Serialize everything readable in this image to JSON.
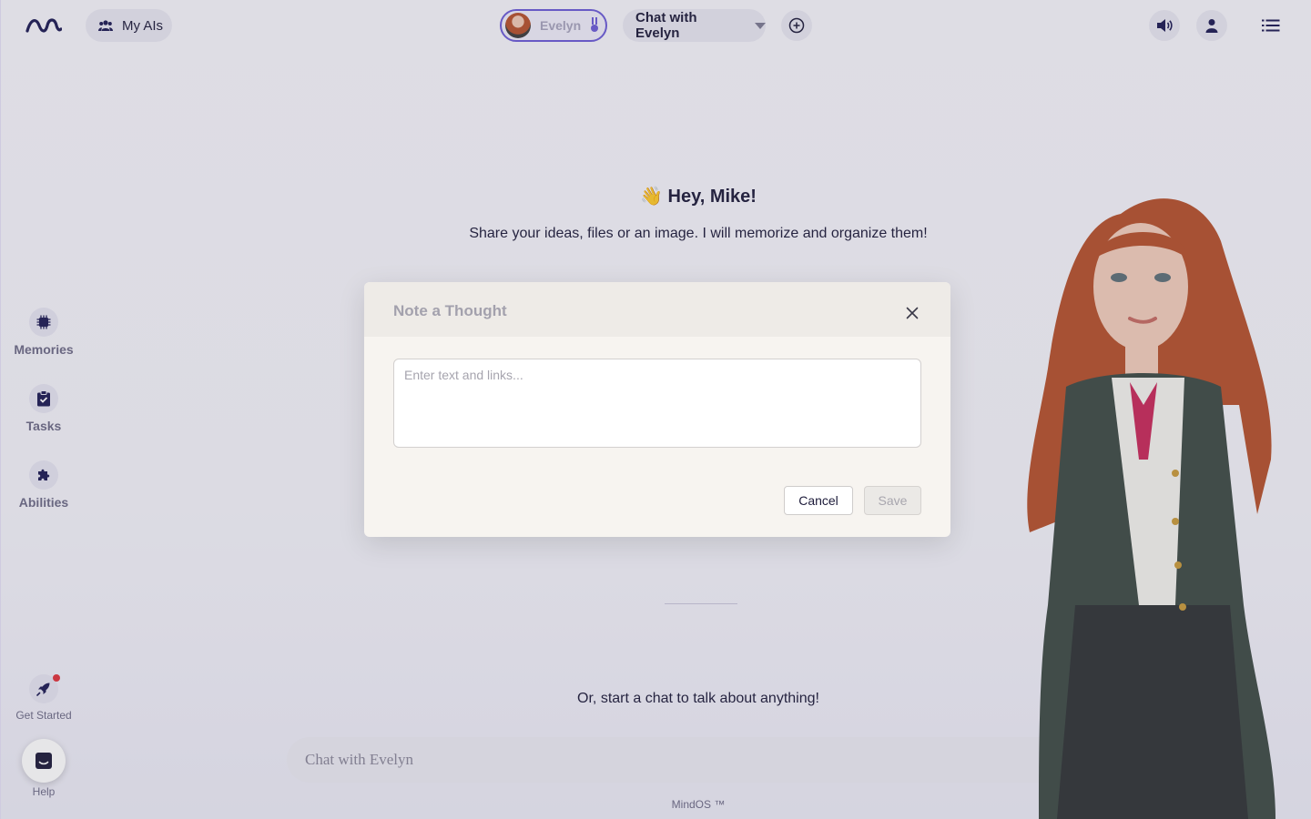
{
  "header": {
    "my_ais_label": "My AIs",
    "avatar_name": "Evelyn",
    "chat_selector_label": "Chat with Evelyn"
  },
  "sidebar": {
    "items": [
      {
        "label": "Memories",
        "icon": "chip-icon"
      },
      {
        "label": "Tasks",
        "icon": "clipboard-check-icon"
      },
      {
        "label": "Abilities",
        "icon": "puzzle-icon"
      }
    ],
    "get_started_label": "Get Started",
    "help_label": "Help"
  },
  "main": {
    "greeting_emoji": "👋",
    "greeting": "Hey, Mike!",
    "subtitle": "Share your ideas, files or an image. I will memorize and organize them!",
    "start_chat_text": "Or, start a chat to talk about anything!",
    "chat_placeholder": "Chat with Evelyn",
    "footer": "MindOS ™"
  },
  "modal": {
    "title": "Note a Thought",
    "textarea_placeholder": "Enter text and links...",
    "textarea_value": "",
    "cancel_label": "Cancel",
    "save_label": "Save"
  },
  "colors": {
    "accent": "#6b5bd6",
    "navy": "#1d1b54",
    "notification": "#e0323b"
  }
}
